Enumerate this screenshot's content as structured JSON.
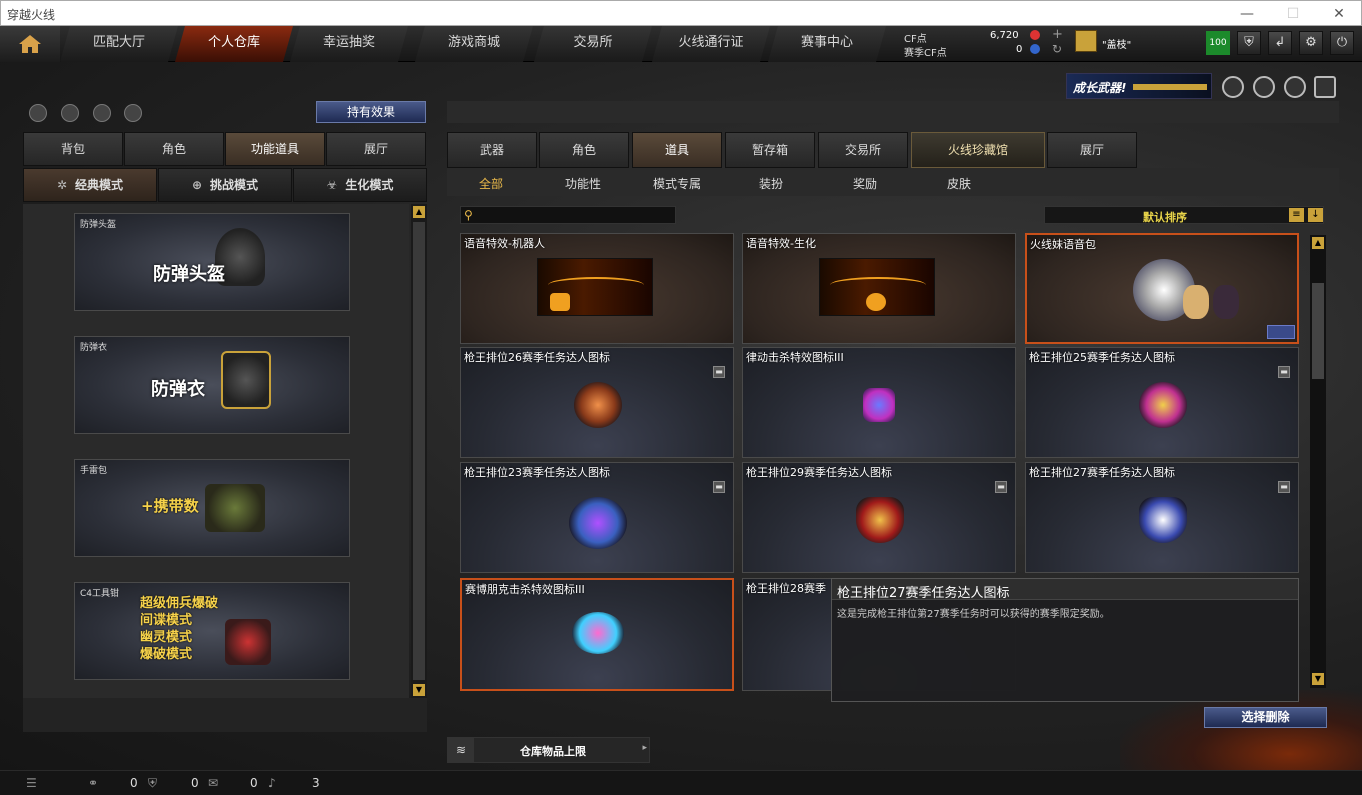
{
  "window": {
    "title": "穿越火线",
    "minimize": "—",
    "maximize": "☐",
    "close": "✕"
  },
  "nav": {
    "tabs": [
      "匹配大厅",
      "个人仓库",
      "幸运抽奖",
      "游戏商城",
      "交易所",
      "火线通行证",
      "赛事中心"
    ],
    "active": "个人仓库"
  },
  "currency": {
    "cf_label": "CF点",
    "cf_value": "6,720",
    "match_label": "赛季CF点",
    "match_value": "0"
  },
  "user": {
    "name": "\"盖枝\"",
    "level": "100"
  },
  "banner": {
    "text": "成长武器!"
  },
  "left": {
    "effect_button": "持有效果",
    "tabs": [
      "背包",
      "角色",
      "功能道具",
      "展厅"
    ],
    "active_tab": "功能道具",
    "modes": [
      "经典模式",
      "挑战模式",
      "生化模式"
    ],
    "items": [
      {
        "caption": "防弹头盔",
        "title": "防弹头盔"
      },
      {
        "caption": "防弹衣",
        "title": "防弹衣"
      },
      {
        "caption": "手雷包",
        "title": "+携带数"
      },
      {
        "caption": "C4工具钳",
        "lines": [
          "超级佣兵爆破",
          "间谍模式",
          "幽灵模式",
          "爆破模式"
        ]
      }
    ]
  },
  "right": {
    "tabs": [
      "武器",
      "角色",
      "道具",
      "暂存箱",
      "交易所",
      "火线珍藏馆",
      "展厅"
    ],
    "active_tab": "道具",
    "subtabs": [
      "全部",
      "功能性",
      "模式专属",
      "装扮",
      "奖励",
      "皮肤"
    ],
    "active_subtab": "全部",
    "search_placeholder": "",
    "sort_label": "默认排序",
    "cards": [
      {
        "name": "语音特效-机器人"
      },
      {
        "name": "语音特效-生化"
      },
      {
        "name": "火线妹语音包"
      },
      {
        "name": "枪王排位26赛季任务达人图标"
      },
      {
        "name": "律动击杀特效图标III"
      },
      {
        "name": "枪王排位25赛季任务达人图标"
      },
      {
        "name": "枪王排位23赛季任务达人图标"
      },
      {
        "name": "枪王排位29赛季任务达人图标"
      },
      {
        "name": "枪王排位27赛季任务达人图标"
      },
      {
        "name": "赛博朋克击杀特效图标III"
      },
      {
        "name": "枪王排位28赛季"
      }
    ],
    "tooltip": {
      "title": "枪王排位27赛季任务达人图标",
      "desc": "这是完成枪王排位第27赛季任务时可以获得的赛季限定奖励。"
    },
    "delete_button": "选择删除",
    "capacity_label": "仓库物品上限"
  },
  "status": {
    "v1": "0",
    "v2": "0",
    "v3": "0",
    "v4": "3"
  }
}
